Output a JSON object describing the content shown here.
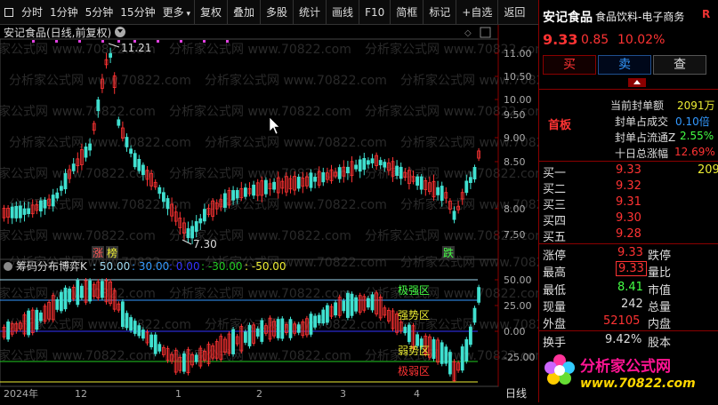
{
  "toolbar": {
    "items": [
      "分时",
      "1分钟",
      "5分钟",
      "15分钟",
      "更多",
      "复权",
      "叠加",
      "多股",
      "统计",
      "画线",
      "F10",
      "简框",
      "标记",
      "+自选",
      "返回"
    ],
    "icon": "square-icon"
  },
  "title": "安记食品(日线,前复权)",
  "annotations": {
    "high": "11.21",
    "low": "7.30",
    "zhang": "涨",
    "bang": "榜",
    "die": "跌"
  },
  "indicator": {
    "label": "筹码分布博弈K",
    "v1": ": 50.00",
    "v2": ": 30.00",
    "v3": ": 0.00",
    "v4": ": -30.00",
    "v5": ": -50.00",
    "zones": [
      "极强区",
      "强势区",
      "弱势区",
      "极弱区"
    ]
  },
  "axis": {
    "price_ticks": [
      "11.00",
      "10.50",
      "10.00",
      "9.50",
      "9.00",
      "8.50",
      "8.00",
      "7.50"
    ],
    "ind_ticks": [
      "50.00",
      "25.00",
      "0.00",
      "-25.00"
    ],
    "dates": [
      "2024年",
      "12",
      "1",
      "2",
      "3",
      "4"
    ],
    "period": "日线"
  },
  "watermark": "分析家公式网 www.70822.com",
  "stock": {
    "name": "安记食品",
    "industry": "食品饮料-电子商务",
    "r": "R",
    "price": "9.33",
    "change": "0.85",
    "pct": "10.02%",
    "buy": "买",
    "sell": "卖",
    "query": "查",
    "tag": "首板",
    "seal": [
      {
        "k": "当前封单额",
        "v": "2091万"
      },
      {
        "k": "封单占成交",
        "v": "0.10倍"
      },
      {
        "k": "封单占流通Z",
        "v": "2.55%"
      },
      {
        "k": "十日总涨幅",
        "v": "12.69%"
      }
    ],
    "bids": [
      {
        "k": "买一",
        "p": "9.33",
        "q": "209"
      },
      {
        "k": "买二",
        "p": "9.32",
        "q": ""
      },
      {
        "k": "买三",
        "p": "9.31",
        "q": ""
      },
      {
        "k": "买四",
        "p": "9.30",
        "q": ""
      },
      {
        "k": "买五",
        "p": "9.28",
        "q": ""
      }
    ],
    "stats": {
      "zt_k": "涨停",
      "zt_v": "9.33",
      "dt_k": "跌停",
      "hi_k": "最高",
      "hi_v": "9.33",
      "lb_k": "量比",
      "lo_k": "最低",
      "lo_v": "8.41",
      "sz_k": "市值",
      "xl_k": "现量",
      "xl_v": "242",
      "zl_k": "总量",
      "wp_k": "外盘",
      "wp_v": "52105",
      "np_k": "内盘",
      "hs_k": "换手",
      "hs_v": "9.42%",
      "gb_k": "股本"
    }
  },
  "brand": {
    "text": "分析家公式网",
    "url": "www.70822.com"
  },
  "colors": {
    "up": "#ff3333",
    "down": "#40e0d0",
    "accent": "#8b0000"
  }
}
